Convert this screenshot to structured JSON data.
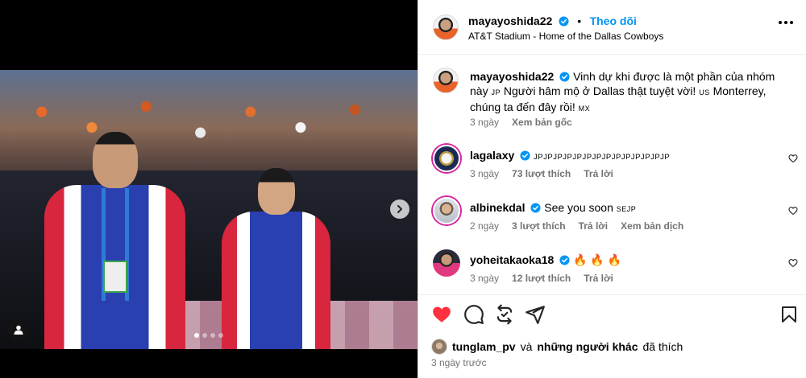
{
  "post": {
    "author": "mayayoshida22",
    "follow_label": "Theo dõi",
    "location": "AT&T Stadium - Home of the Dallas Cowboys",
    "caption_lines": [
      "Vinh dự khi được là một phần của nhóm này",
      "Người hâm mộ ở Dallas thật tuyệt vời!",
      "Monterrey, chúng ta",
      "đến đây rồi!"
    ],
    "caption_flags": [
      "JP",
      "US",
      "MX"
    ],
    "caption_time": "3 ngày",
    "see_original": "Xem bản gốc"
  },
  "comments": [
    {
      "user": "lagalaxy",
      "verified": true,
      "text": "JPJPJPJPJPJPJPJPJPJPJPJPJPJP",
      "time": "3 ngày",
      "likes": "73 lượt thích",
      "reply": "Trả lời",
      "translate": ""
    },
    {
      "user": "albinekdal",
      "verified": true,
      "text": "See you soon",
      "flags": "SEJP",
      "time": "2 ngày",
      "likes": "3 lượt thích",
      "reply": "Trả lời",
      "translate": "Xem bản dịch"
    },
    {
      "user": "yoheitakaoka18",
      "verified": true,
      "text": "🔥 🔥 🔥",
      "time": "3 ngày",
      "likes": "12 lượt thích",
      "reply": "Trả lời",
      "translate": ""
    }
  ],
  "likes_line": {
    "user": "tunglam_pv",
    "middle": "và",
    "others": "những người khác",
    "suffix": "đã thích"
  },
  "post_time": "3 ngày trước",
  "carousel": {
    "count": 4,
    "active_index": 0
  },
  "colors": {
    "accent": "#0095f6",
    "like_red": "#ff3040",
    "verified": "#0095f6"
  },
  "icons": {
    "like": "heart-filled-icon",
    "comment": "comment-bubble-icon",
    "repost": "repost-icon",
    "share": "send-icon",
    "save": "bookmark-icon",
    "more": "more-horizontal-icon",
    "next": "chevron-right-icon",
    "tag": "user-tag-icon"
  }
}
